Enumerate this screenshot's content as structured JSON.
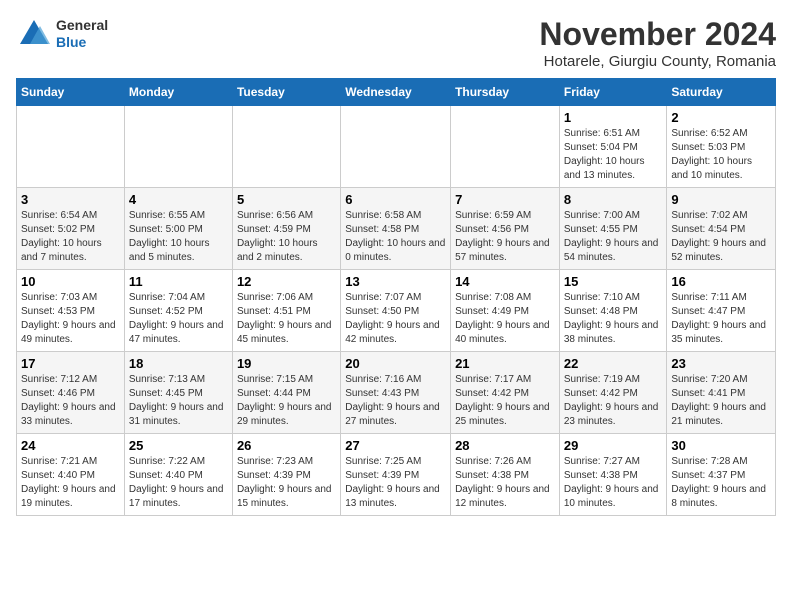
{
  "header": {
    "logo_line1": "General",
    "logo_line2": "Blue",
    "month_title": "November 2024",
    "subtitle": "Hotarele, Giurgiu County, Romania"
  },
  "weekdays": [
    "Sunday",
    "Monday",
    "Tuesday",
    "Wednesday",
    "Thursday",
    "Friday",
    "Saturday"
  ],
  "weeks": [
    [
      {
        "day": "",
        "info": ""
      },
      {
        "day": "",
        "info": ""
      },
      {
        "day": "",
        "info": ""
      },
      {
        "day": "",
        "info": ""
      },
      {
        "day": "",
        "info": ""
      },
      {
        "day": "1",
        "info": "Sunrise: 6:51 AM\nSunset: 5:04 PM\nDaylight: 10 hours and 13 minutes."
      },
      {
        "day": "2",
        "info": "Sunrise: 6:52 AM\nSunset: 5:03 PM\nDaylight: 10 hours and 10 minutes."
      }
    ],
    [
      {
        "day": "3",
        "info": "Sunrise: 6:54 AM\nSunset: 5:02 PM\nDaylight: 10 hours and 7 minutes."
      },
      {
        "day": "4",
        "info": "Sunrise: 6:55 AM\nSunset: 5:00 PM\nDaylight: 10 hours and 5 minutes."
      },
      {
        "day": "5",
        "info": "Sunrise: 6:56 AM\nSunset: 4:59 PM\nDaylight: 10 hours and 2 minutes."
      },
      {
        "day": "6",
        "info": "Sunrise: 6:58 AM\nSunset: 4:58 PM\nDaylight: 10 hours and 0 minutes."
      },
      {
        "day": "7",
        "info": "Sunrise: 6:59 AM\nSunset: 4:56 PM\nDaylight: 9 hours and 57 minutes."
      },
      {
        "day": "8",
        "info": "Sunrise: 7:00 AM\nSunset: 4:55 PM\nDaylight: 9 hours and 54 minutes."
      },
      {
        "day": "9",
        "info": "Sunrise: 7:02 AM\nSunset: 4:54 PM\nDaylight: 9 hours and 52 minutes."
      }
    ],
    [
      {
        "day": "10",
        "info": "Sunrise: 7:03 AM\nSunset: 4:53 PM\nDaylight: 9 hours and 49 minutes."
      },
      {
        "day": "11",
        "info": "Sunrise: 7:04 AM\nSunset: 4:52 PM\nDaylight: 9 hours and 47 minutes."
      },
      {
        "day": "12",
        "info": "Sunrise: 7:06 AM\nSunset: 4:51 PM\nDaylight: 9 hours and 45 minutes."
      },
      {
        "day": "13",
        "info": "Sunrise: 7:07 AM\nSunset: 4:50 PM\nDaylight: 9 hours and 42 minutes."
      },
      {
        "day": "14",
        "info": "Sunrise: 7:08 AM\nSunset: 4:49 PM\nDaylight: 9 hours and 40 minutes."
      },
      {
        "day": "15",
        "info": "Sunrise: 7:10 AM\nSunset: 4:48 PM\nDaylight: 9 hours and 38 minutes."
      },
      {
        "day": "16",
        "info": "Sunrise: 7:11 AM\nSunset: 4:47 PM\nDaylight: 9 hours and 35 minutes."
      }
    ],
    [
      {
        "day": "17",
        "info": "Sunrise: 7:12 AM\nSunset: 4:46 PM\nDaylight: 9 hours and 33 minutes."
      },
      {
        "day": "18",
        "info": "Sunrise: 7:13 AM\nSunset: 4:45 PM\nDaylight: 9 hours and 31 minutes."
      },
      {
        "day": "19",
        "info": "Sunrise: 7:15 AM\nSunset: 4:44 PM\nDaylight: 9 hours and 29 minutes."
      },
      {
        "day": "20",
        "info": "Sunrise: 7:16 AM\nSunset: 4:43 PM\nDaylight: 9 hours and 27 minutes."
      },
      {
        "day": "21",
        "info": "Sunrise: 7:17 AM\nSunset: 4:42 PM\nDaylight: 9 hours and 25 minutes."
      },
      {
        "day": "22",
        "info": "Sunrise: 7:19 AM\nSunset: 4:42 PM\nDaylight: 9 hours and 23 minutes."
      },
      {
        "day": "23",
        "info": "Sunrise: 7:20 AM\nSunset: 4:41 PM\nDaylight: 9 hours and 21 minutes."
      }
    ],
    [
      {
        "day": "24",
        "info": "Sunrise: 7:21 AM\nSunset: 4:40 PM\nDaylight: 9 hours and 19 minutes."
      },
      {
        "day": "25",
        "info": "Sunrise: 7:22 AM\nSunset: 4:40 PM\nDaylight: 9 hours and 17 minutes."
      },
      {
        "day": "26",
        "info": "Sunrise: 7:23 AM\nSunset: 4:39 PM\nDaylight: 9 hours and 15 minutes."
      },
      {
        "day": "27",
        "info": "Sunrise: 7:25 AM\nSunset: 4:39 PM\nDaylight: 9 hours and 13 minutes."
      },
      {
        "day": "28",
        "info": "Sunrise: 7:26 AM\nSunset: 4:38 PM\nDaylight: 9 hours and 12 minutes."
      },
      {
        "day": "29",
        "info": "Sunrise: 7:27 AM\nSunset: 4:38 PM\nDaylight: 9 hours and 10 minutes."
      },
      {
        "day": "30",
        "info": "Sunrise: 7:28 AM\nSunset: 4:37 PM\nDaylight: 9 hours and 8 minutes."
      }
    ]
  ]
}
